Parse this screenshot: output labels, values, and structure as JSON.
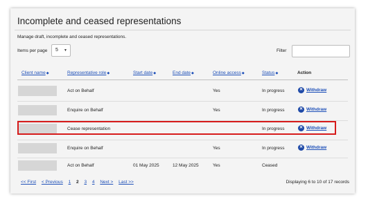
{
  "panel": {
    "title": "Incomplete and ceased representations",
    "description": "Manage draft, incomplete and ceased representations."
  },
  "controls": {
    "items_per_page_label": "Items per page",
    "items_per_page_value": "5",
    "filter_label": "Filter",
    "filter_value": ""
  },
  "table": {
    "headers": {
      "client_name": "Client name",
      "representative_role": "Representative role",
      "start_date": "Start date",
      "end_date": "End date",
      "online_access": "Online access",
      "status": "Status",
      "action": "Action"
    },
    "rows": [
      {
        "client_name": "",
        "role": "Act on Behalf",
        "start_date": "",
        "end_date": "",
        "online_access": "Yes",
        "status": "In progress",
        "action": "Withdraw"
      },
      {
        "client_name": "",
        "role": "Enquire on Behalf",
        "start_date": "",
        "end_date": "",
        "online_access": "Yes",
        "status": "In progress",
        "action": "Withdraw"
      },
      {
        "client_name": "",
        "role": "Cease representation",
        "start_date": "",
        "end_date": "",
        "online_access": "",
        "status": "In progress",
        "action": "Withdraw"
      },
      {
        "client_name": "",
        "role": "Enquire on Behalf",
        "start_date": "",
        "end_date": "",
        "online_access": "Yes",
        "status": "In progress",
        "action": "Withdraw"
      },
      {
        "client_name": "",
        "role": "Act on Behalf",
        "start_date": "01 May 2025",
        "end_date": "12 May 2025",
        "online_access": "Yes",
        "status": "Ceased",
        "action": ""
      }
    ],
    "sort_icon": "sort-arrows-icon",
    "action_icon": "close-circle-icon"
  },
  "pagination": {
    "first": "<< First",
    "previous": "< Previous",
    "pages": [
      "1",
      "2",
      "3",
      "4"
    ],
    "current_page": "2",
    "next": "Next >",
    "last": "Last >>",
    "summary": "Displaying 6 to 10 of 17 records"
  },
  "colors": {
    "link": "#1d4fb8",
    "highlight_border": "#d61a1a",
    "panel_bg": "#f4f4f4"
  }
}
